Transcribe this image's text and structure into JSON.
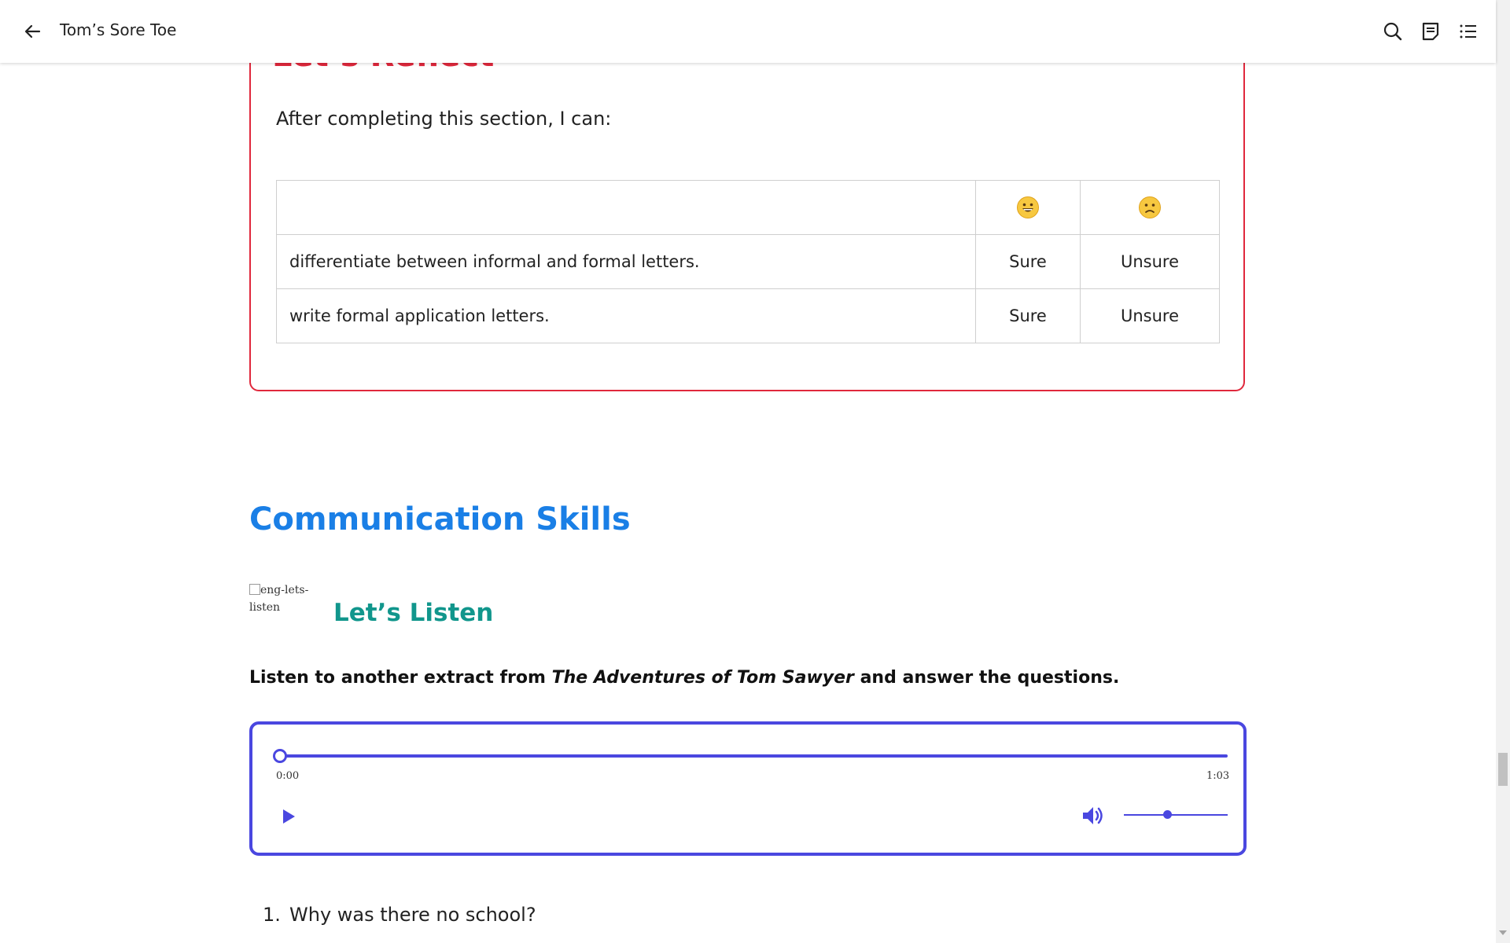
{
  "header": {
    "title": "Tom’s Sore Toe"
  },
  "reflect": {
    "heading": "Let’s Reflect",
    "intro": "After completing this section, I can:",
    "table": {
      "rows": [
        {
          "text": "differentiate between informal and formal letters.",
          "sure": "Sure",
          "unsure": "Unsure"
        },
        {
          "text": "write formal application letters.",
          "sure": "Sure",
          "unsure": "Unsure"
        }
      ]
    }
  },
  "communication": {
    "title": "Communication Skills",
    "image_alt": "eng-lets-listen",
    "listen_title": "Let’s Listen",
    "instruction_before": "Listen to another extract from ",
    "instruction_italic": "The Adventures of Tom Sawyer",
    "instruction_after": " and answer the questions."
  },
  "audio": {
    "current_time": "0:00",
    "duration": "1:03",
    "progress": 0,
    "volume": 0.4,
    "accent_color": "#4a47e0"
  },
  "questions": [
    {
      "number": "1.",
      "text": "Why was there no school?"
    }
  ],
  "colors": {
    "reflect": "#e0283c",
    "section": "#1a7fe6",
    "subsection": "#11968c"
  }
}
